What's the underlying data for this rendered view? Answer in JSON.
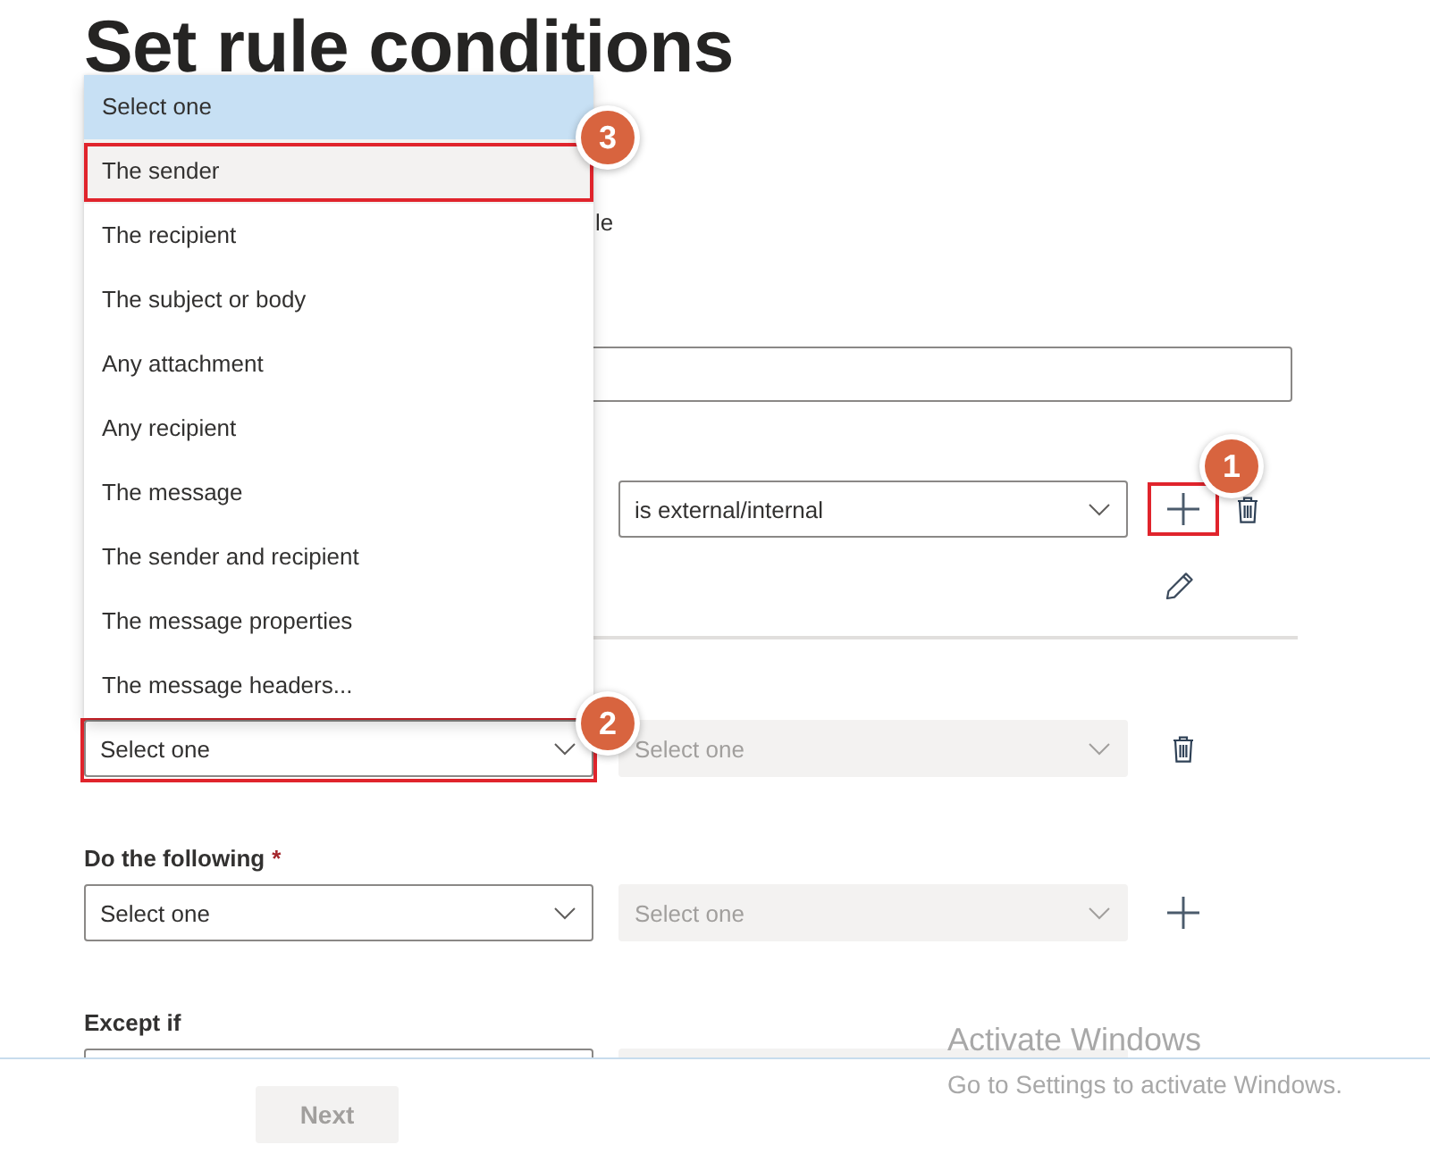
{
  "title": "Set rule conditions",
  "description_fragment": "le",
  "condition_rows": [
    {
      "operator": {
        "value": "is external/internal",
        "disabled": false,
        "highlighted": false
      },
      "actions": [
        {
          "kind": "add",
          "highlighted": true,
          "callout": "1"
        },
        {
          "kind": "delete",
          "highlighted": false
        }
      ],
      "editable": true
    },
    {
      "property": {
        "placeholder": "Select one",
        "disabled": false,
        "highlighted": true,
        "callout": "2"
      },
      "operator": {
        "placeholder": "Select one",
        "disabled": true,
        "highlighted": false
      },
      "actions": [
        {
          "kind": "delete",
          "highlighted": false
        }
      ],
      "editable": false
    }
  ],
  "action_section": {
    "label": "Do the following",
    "required_marker": "*",
    "property": {
      "placeholder": "Select one",
      "disabled": false,
      "highlighted": false
    },
    "operator": {
      "placeholder": "Select one",
      "disabled": true,
      "highlighted": false
    },
    "actions": [
      {
        "kind": "add",
        "highlighted": false
      }
    ],
    "editable": false
  },
  "exception_section": {
    "label": "Except if",
    "property": {
      "disabled": false,
      "highlighted": false
    },
    "operator": {
      "disabled": true,
      "highlighted": false
    },
    "editable": false
  },
  "dropdown_menu": {
    "options": [
      {
        "label": "Select one",
        "selected": true,
        "hovered": false,
        "highlighted": false
      },
      {
        "label": "The sender",
        "selected": false,
        "hovered": true,
        "highlighted": true,
        "callout": "3"
      },
      {
        "label": "The recipient",
        "selected": false,
        "hovered": false,
        "highlighted": false
      },
      {
        "label": "The subject or body",
        "selected": false,
        "hovered": false,
        "highlighted": false
      },
      {
        "label": "Any attachment",
        "selected": false,
        "hovered": false,
        "highlighted": false
      },
      {
        "label": "Any recipient",
        "selected": false,
        "hovered": false,
        "highlighted": false
      },
      {
        "label": "The message",
        "selected": false,
        "hovered": false,
        "highlighted": false
      },
      {
        "label": "The sender and recipient",
        "selected": false,
        "hovered": false,
        "highlighted": false
      },
      {
        "label": "The message properties",
        "selected": false,
        "hovered": false,
        "highlighted": false
      },
      {
        "label": "The message headers...",
        "selected": false,
        "hovered": false,
        "highlighted": false
      }
    ]
  },
  "footer": {
    "next_button": {
      "label": "Next",
      "disabled": true
    }
  },
  "activation_notice": {
    "title": "Activate Windows",
    "message": "Go to Settings to activate Windows."
  }
}
